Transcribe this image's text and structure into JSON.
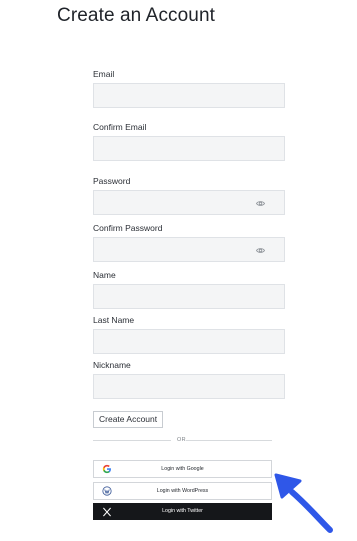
{
  "page": {
    "title": "Create an Account"
  },
  "form": {
    "fields": [
      {
        "label": "Email",
        "value": "",
        "type": "text",
        "password_toggle": false
      },
      {
        "label": "Confirm Email",
        "value": "",
        "type": "text",
        "password_toggle": false
      },
      {
        "label": "Password",
        "value": "",
        "type": "password",
        "password_toggle": true
      },
      {
        "label": "Confirm Password",
        "value": "",
        "type": "password",
        "password_toggle": true
      },
      {
        "label": "Name",
        "value": "",
        "type": "text",
        "password_toggle": false
      },
      {
        "label": "Last Name",
        "value": "",
        "type": "text",
        "password_toggle": false
      },
      {
        "label": "Nickname",
        "value": "",
        "type": "text",
        "password_toggle": false
      }
    ],
    "submit_label": "Create Account"
  },
  "divider": {
    "label": "OR"
  },
  "social_logins": {
    "google": {
      "label": "Login with Google",
      "icon": "google-icon"
    },
    "wordpress": {
      "label": "Login with WordPress",
      "icon": "wordpress-icon"
    },
    "twitter": {
      "label": "Login with Twitter",
      "icon": "x-icon"
    }
  },
  "annotation": {
    "arrow_icon": "pointer-arrow-icon",
    "arrow_color": "#2f57e8"
  },
  "colors": {
    "input_background": "#f4f5f6",
    "input_border": "#dfe2e6",
    "twitter_button_background": "#15171a",
    "text": "#1f2329"
  }
}
